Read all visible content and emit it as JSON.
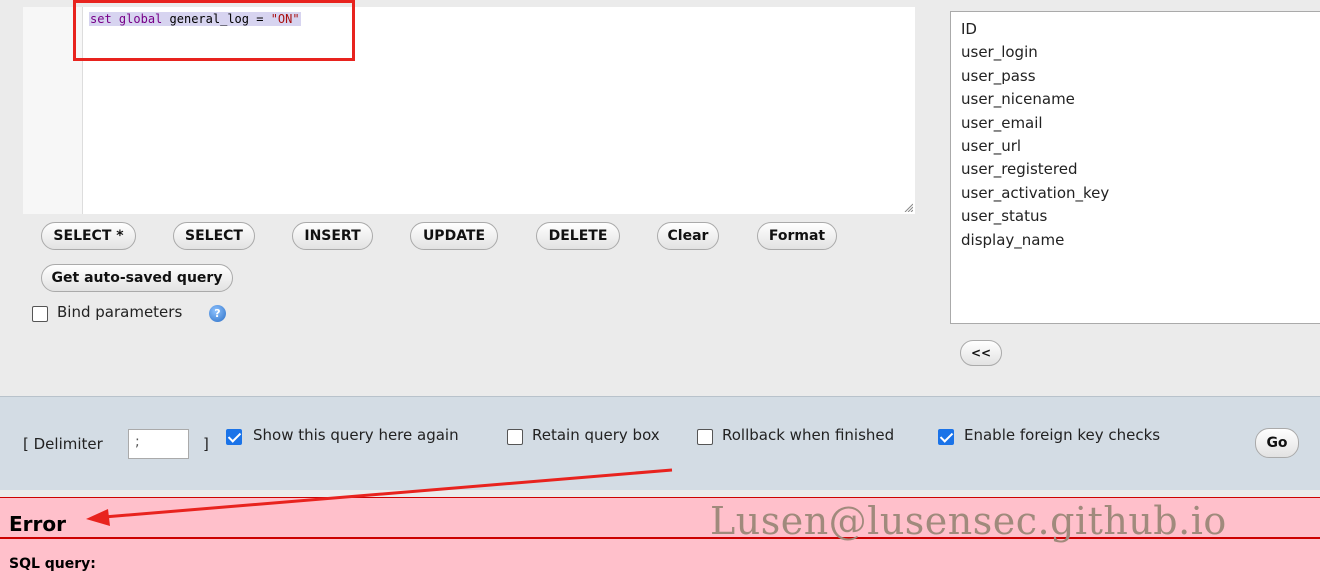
{
  "editor": {
    "code": {
      "kw1": "set",
      "kw2": "global",
      "ident": "general_log",
      "op": "=",
      "str": "\"ON\""
    }
  },
  "buttons": {
    "select_star": "SELECT *",
    "select": "SELECT",
    "insert": "INSERT",
    "update": "UPDATE",
    "delete": "DELETE",
    "clear": "Clear",
    "format": "Format",
    "autosaved": "Get auto-saved query",
    "move_left": "<<",
    "go": "Go"
  },
  "bind_parameters": {
    "label": "Bind parameters",
    "checked": false
  },
  "fields": [
    "ID",
    "user_login",
    "user_pass",
    "user_nicename",
    "user_email",
    "user_url",
    "user_registered",
    "user_activation_key",
    "user_status",
    "display_name"
  ],
  "footer": {
    "delimiter_open": "[ Delimiter",
    "delimiter_value": ";",
    "delimiter_close": "]",
    "options": [
      {
        "label": "Show this query here again",
        "checked": true
      },
      {
        "label": "Retain query box",
        "checked": false
      },
      {
        "label": "Rollback when finished",
        "checked": false
      },
      {
        "label": "Enable foreign key checks",
        "checked": true
      }
    ]
  },
  "error": {
    "title": "Error",
    "sql_label": "SQL query:"
  },
  "watermark": "Lusen@lusensec.github.io",
  "colors": {
    "annotation_red": "#e8231e",
    "checkbox_blue": "#1a73e8",
    "error_bg": "#ffc0cb"
  }
}
